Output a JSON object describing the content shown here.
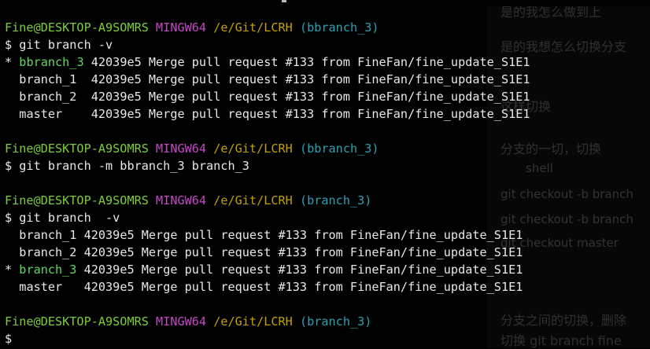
{
  "background_doc": {
    "lines": [
      "是的我怎么做到上",
      "是的我想怎么切换分支",
      "这样切换",
      "分支的一切，切换",
      "shell",
      "git checkout -b branch",
      "git checkout -b branch",
      "git checkout master",
      "分支之间的切换，删除",
      "切换 git branch fine"
    ]
  },
  "terminal": {
    "blocks": [
      {
        "prompt": {
          "user": "Fine@DESKTOP-A9SOMRS",
          "shell": "MINGW64",
          "path": "/e/Git/LCRH",
          "branch": "(bbranch_3)"
        },
        "command": "$ git branch -v",
        "output": [
          {
            "marker": "* ",
            "name": "bbranch_3",
            "pad": " ",
            "rest": "42039e5 Merge pull request #133 from FineFan/fine_update_S1E1",
            "current": true
          },
          {
            "marker": "  ",
            "name": "branch_1",
            "pad": "  ",
            "rest": "42039e5 Merge pull request #133 from FineFan/fine_update_S1E1",
            "current": false
          },
          {
            "marker": "  ",
            "name": "branch_2",
            "pad": "  ",
            "rest": "42039e5 Merge pull request #133 from FineFan/fine_update_S1E1",
            "current": false
          },
          {
            "marker": "  ",
            "name": "master",
            "pad": "    ",
            "rest": "42039e5 Merge pull request #133 from FineFan/fine_update_S1E1",
            "current": false
          }
        ]
      },
      {
        "prompt": {
          "user": "Fine@DESKTOP-A9SOMRS",
          "shell": "MINGW64",
          "path": "/e/Git/LCRH",
          "branch": "(bbranch_3)"
        },
        "command": "$ git branch -m bbranch_3 branch_3",
        "output": []
      },
      {
        "prompt": {
          "user": "Fine@DESKTOP-A9SOMRS",
          "shell": "MINGW64",
          "path": "/e/Git/LCRH",
          "branch": "(branch_3)"
        },
        "command": "$ git branch  -v",
        "output": [
          {
            "marker": "  ",
            "name": "branch_1",
            "pad": " ",
            "rest": "42039e5 Merge pull request #133 from FineFan/fine_update_S1E1",
            "current": false
          },
          {
            "marker": "  ",
            "name": "branch_2",
            "pad": " ",
            "rest": "42039e5 Merge pull request #133 from FineFan/fine_update_S1E1",
            "current": false
          },
          {
            "marker": "* ",
            "name": "branch_3",
            "pad": " ",
            "rest": "42039e5 Merge pull request #133 from FineFan/fine_update_S1E1",
            "current": true
          },
          {
            "marker": "  ",
            "name": "master",
            "pad": "   ",
            "rest": "42039e5 Merge pull request #133 from FineFan/fine_update_S1E1",
            "current": false
          }
        ]
      },
      {
        "prompt": {
          "user": "Fine@DESKTOP-A9SOMRS",
          "shell": "MINGW64",
          "path": "/e/Git/LCRH",
          "branch": "(branch_3)"
        },
        "command": "$",
        "output": []
      }
    ]
  },
  "colors": {
    "background": "#000000",
    "text": "#e8e8e8",
    "user_host": "#7ccd3c",
    "shell": "#c646c6",
    "path": "#c4a000",
    "branch_prompt": "#2aa1b3",
    "current_branch": "#5fd85f"
  }
}
